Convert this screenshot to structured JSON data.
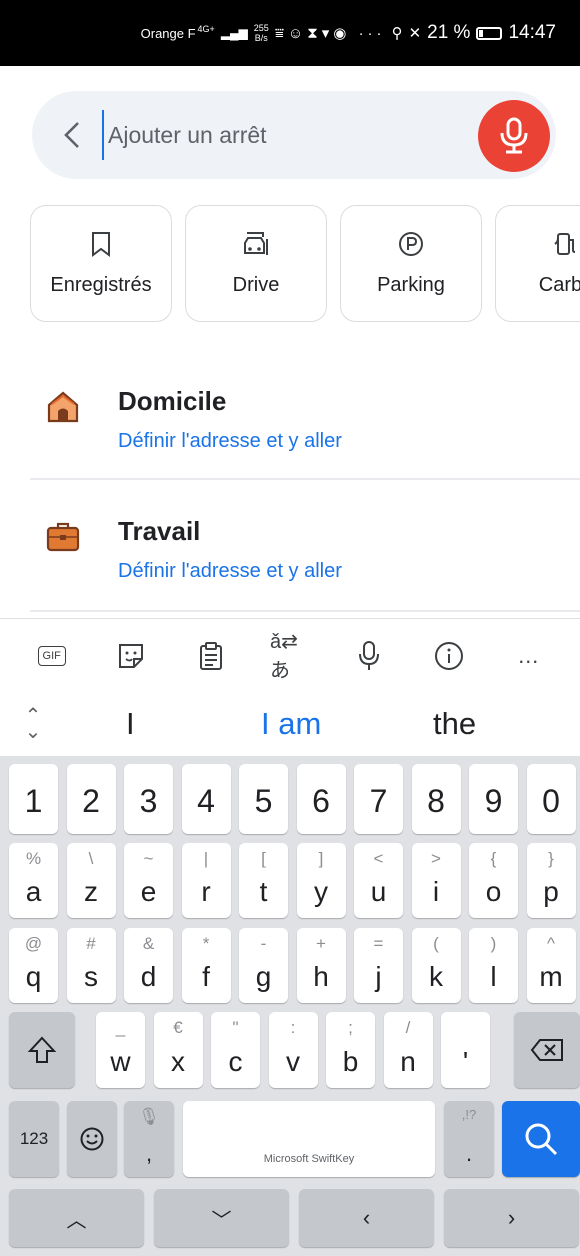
{
  "status_bar": {
    "carrier": "Orange F",
    "network": "4G+",
    "data_rate_value": "255",
    "data_rate_unit": "B/s",
    "battery_percent": "21 %",
    "battery_level": 0.21,
    "time": "14:47"
  },
  "search": {
    "placeholder": "Ajouter un arrêt",
    "value": ""
  },
  "chips": [
    {
      "label": "Enregistrés",
      "icon": "bookmark-icon"
    },
    {
      "label": "Drive",
      "icon": "drive-car-icon"
    },
    {
      "label": "Parking",
      "icon": "parking-icon"
    },
    {
      "label": "Carbu",
      "icon": "fuel-icon"
    }
  ],
  "places": [
    {
      "title": "Domicile",
      "subtitle": "Définir l'adresse et y aller",
      "icon": "home-icon"
    },
    {
      "title": "Travail",
      "subtitle": "Définir l'adresse et y aller",
      "icon": "briefcase-icon"
    }
  ],
  "keyboard_toolbar": [
    {
      "label": "GIF",
      "icon": "gif-icon"
    },
    {
      "label": "",
      "icon": "sticker-icon"
    },
    {
      "label": "",
      "icon": "clipboard-icon"
    },
    {
      "label": "",
      "icon": "translate-icon"
    },
    {
      "label": "",
      "icon": "microphone-icon"
    },
    {
      "label": "",
      "icon": "info-icon"
    },
    {
      "label": "…",
      "icon": "more-icon"
    }
  ],
  "suggestions": {
    "left": "I",
    "middle": "I am",
    "right": "the"
  },
  "keyboard": {
    "number_row": [
      "1",
      "2",
      "3",
      "4",
      "5",
      "6",
      "7",
      "8",
      "9",
      "0"
    ],
    "row1": [
      {
        "main": "a",
        "hint": "%"
      },
      {
        "main": "z",
        "hint": "\\"
      },
      {
        "main": "e",
        "hint": "~"
      },
      {
        "main": "r",
        "hint": "|"
      },
      {
        "main": "t",
        "hint": "["
      },
      {
        "main": "y",
        "hint": "]"
      },
      {
        "main": "u",
        "hint": "<"
      },
      {
        "main": "i",
        "hint": ">"
      },
      {
        "main": "o",
        "hint": "{"
      },
      {
        "main": "p",
        "hint": "}"
      }
    ],
    "row2": [
      {
        "main": "q",
        "hint": "@"
      },
      {
        "main": "s",
        "hint": "#"
      },
      {
        "main": "d",
        "hint": "&"
      },
      {
        "main": "f",
        "hint": "*"
      },
      {
        "main": "g",
        "hint": "-"
      },
      {
        "main": "h",
        "hint": "+"
      },
      {
        "main": "j",
        "hint": "="
      },
      {
        "main": "k",
        "hint": "("
      },
      {
        "main": "l",
        "hint": ")"
      },
      {
        "main": "m",
        "hint": "^"
      }
    ],
    "row3": [
      {
        "main": "w",
        "hint": "_"
      },
      {
        "main": "x",
        "hint": "€"
      },
      {
        "main": "c",
        "hint": "\""
      },
      {
        "main": "v",
        "hint": ":"
      },
      {
        "main": "b",
        "hint": ";"
      },
      {
        "main": "n",
        "hint": "/"
      },
      {
        "main": "'",
        "hint": ""
      }
    ],
    "numbers_key": "123",
    "comma_key": ",",
    "space_label": "Microsoft SwiftKey",
    "period_key": ".",
    "period_hint": ",!?",
    "nav": [
      "^",
      "v",
      "<",
      ">"
    ]
  },
  "colors": {
    "accent": "#1a73e8",
    "mic": "#ea4335",
    "keyboard_bg": "#dfe1e5",
    "search_bg": "#eff2f7"
  }
}
